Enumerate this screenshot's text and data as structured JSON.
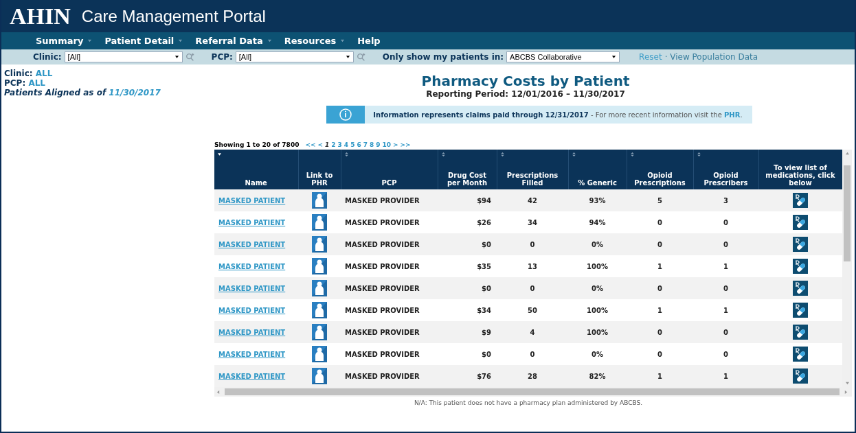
{
  "header": {
    "logo": "AHIN",
    "title": "Care Management Portal"
  },
  "nav": [
    {
      "label": "Summary",
      "dropdown": true
    },
    {
      "label": "Patient Detail",
      "dropdown": true
    },
    {
      "label": "Referral Data",
      "dropdown": true
    },
    {
      "label": "Resources",
      "dropdown": true
    },
    {
      "label": "Help",
      "dropdown": false
    }
  ],
  "filters": {
    "clinic": {
      "label": "Clinic:",
      "value": "[All]"
    },
    "pcp": {
      "label": "PCP:",
      "value": "[All]"
    },
    "only_show": {
      "label": "Only show my patients in:",
      "value": "ABCBS Collaborative"
    },
    "reset_link": "Reset",
    "view_population_link": "· View Population Data"
  },
  "summary": [
    {
      "label": "Clinic:",
      "value": "ALL",
      "italic": false
    },
    {
      "label": "PCP:",
      "value": "ALL",
      "italic": false
    },
    {
      "label": "Patients Aligned as of",
      "value": "11/30/2017",
      "italic": true
    }
  ],
  "report": {
    "title": "Pharmacy Costs by Patient",
    "period": "Reporting Period: 12/01/2016 – 11/30/2017"
  },
  "notice": {
    "text": "**Information represents claims paid through 12/31/2017** - For more recent information visit the",
    "link": "PHR",
    "end": "."
  },
  "pagination": {
    "showing": "Showing 1 to 20 of 7800",
    "first": "<<",
    "prev": "<",
    "pages": [
      {
        "label": "1",
        "selected": true
      },
      {
        "label": "2",
        "selected": false
      },
      {
        "label": "3",
        "selected": false
      },
      {
        "label": "4",
        "selected": false
      },
      {
        "label": "5",
        "selected": false
      },
      {
        "label": "6",
        "selected": false
      },
      {
        "label": "7",
        "selected": false
      },
      {
        "label": "8",
        "selected": false
      },
      {
        "label": "9",
        "selected": false
      },
      {
        "label": "10",
        "selected": false
      }
    ],
    "next": ">",
    "last": ">>"
  },
  "table": {
    "columns": [
      {
        "label": "Name",
        "sortable": true,
        "sorted": true
      },
      {
        "label": "Link to PHR",
        "sortable": false,
        "sorted": false
      },
      {
        "label": "PCP",
        "sortable": true,
        "sorted": false
      },
      {
        "label": "Drug Cost per Month",
        "sortable": true,
        "sorted": false
      },
      {
        "label": "Prescriptions Filled",
        "sortable": true,
        "sorted": false
      },
      {
        "label": "% Generic",
        "sortable": true,
        "sorted": false
      },
      {
        "label": "Opioid Prescriptions",
        "sortable": true,
        "sorted": false
      },
      {
        "label": "Opioid Prescribers",
        "sortable": true,
        "sorted": false
      },
      {
        "label": "To view list of medications, click below",
        "sortable": false,
        "sorted": false
      }
    ],
    "rows": [
      {
        "name": "MASKED PATIENT",
        "pcp": "MASKED PROVIDER",
        "cost": "$94",
        "filled": "42",
        "generic": "93%",
        "opioid_rx": "5",
        "opioid_prescribers": "3"
      },
      {
        "name": "MASKED PATIENT",
        "pcp": "MASKED PROVIDER",
        "cost": "$26",
        "filled": "34",
        "generic": "94%",
        "opioid_rx": "0",
        "opioid_prescribers": "0"
      },
      {
        "name": "MASKED PATIENT",
        "pcp": "MASKED PROVIDER",
        "cost": "$0",
        "filled": "0",
        "generic": "0%",
        "opioid_rx": "0",
        "opioid_prescribers": "0"
      },
      {
        "name": "MASKED PATIENT",
        "pcp": "MASKED PROVIDER",
        "cost": "$35",
        "filled": "13",
        "generic": "100%",
        "opioid_rx": "1",
        "opioid_prescribers": "1"
      },
      {
        "name": "MASKED PATIENT",
        "pcp": "MASKED PROVIDER",
        "cost": "$0",
        "filled": "0",
        "generic": "0%",
        "opioid_rx": "0",
        "opioid_prescribers": "0"
      },
      {
        "name": "MASKED PATIENT",
        "pcp": "MASKED PROVIDER",
        "cost": "$34",
        "filled": "50",
        "generic": "100%",
        "opioid_rx": "1",
        "opioid_prescribers": "1"
      },
      {
        "name": "MASKED PATIENT",
        "pcp": "MASKED PROVIDER",
        "cost": "$9",
        "filled": "4",
        "generic": "100%",
        "opioid_rx": "0",
        "opioid_prescribers": "0"
      },
      {
        "name": "MASKED PATIENT",
        "pcp": "MASKED PROVIDER",
        "cost": "$0",
        "filled": "0",
        "generic": "0%",
        "opioid_rx": "0",
        "opioid_prescribers": "0"
      },
      {
        "name": "MASKED PATIENT",
        "pcp": "MASKED PROVIDER",
        "cost": "$76",
        "filled": "28",
        "generic": "82%",
        "opioid_rx": "1",
        "opioid_prescribers": "1"
      }
    ]
  },
  "footnote": "N/A: This patient does not have a pharmacy plan administered by ABCBS."
}
